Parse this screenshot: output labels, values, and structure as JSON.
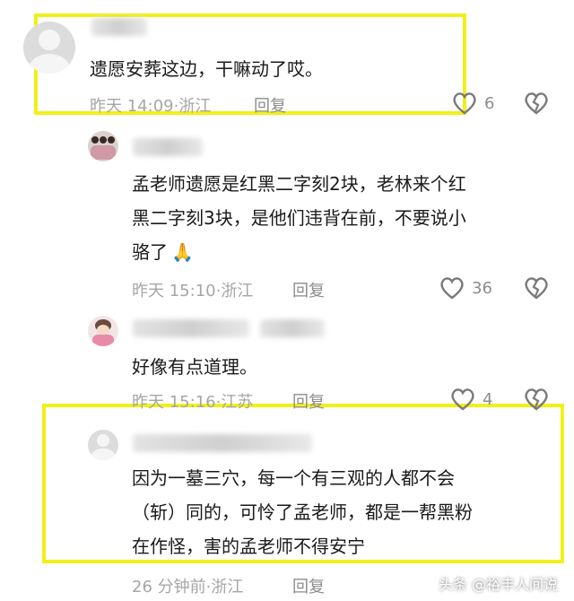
{
  "comments": [
    {
      "text_lines": [
        "遗愿安葬这边，干嘛动了哎。"
      ],
      "time": "昨天 14:09",
      "location": "浙江",
      "reply": "回复",
      "likes": "6"
    },
    {
      "text_lines": [
        "孟老师遗愿是红黑二字刻2块，老林来个红",
        "黑二字刻3块，是他们违背在前，不要说小",
        "骆了"
      ],
      "emoji": "🙏",
      "time": "昨天 15:10",
      "location": "浙江",
      "reply": "回复",
      "likes": "36"
    },
    {
      "text_lines": [
        "好像有点道理。"
      ],
      "time": "昨天 15:16",
      "location": "江苏",
      "reply": "回复",
      "likes": "4"
    },
    {
      "text_lines": [
        "因为一墓三穴，每一个有三观的人都不会",
        "（斩）同的，可怜了孟老师，都是一帮黑粉",
        "在作怪，害的孟老师不得安宁"
      ],
      "time": "26 分钟前",
      "location": "浙江",
      "reply": "回复"
    }
  ],
  "watermark": "头条 @裕丰人间说",
  "colors": {
    "highlight": "#f0f01a",
    "meta": "#a6a6a6"
  }
}
